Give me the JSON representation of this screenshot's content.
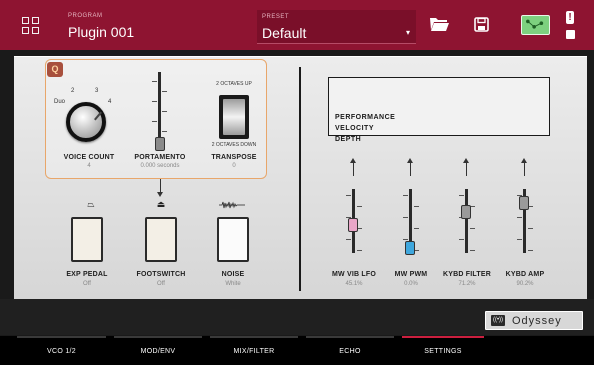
{
  "header": {
    "plugin_caption": "PROGRAM",
    "plugin_name": "Plugin 001",
    "preset_caption": "PRESET",
    "preset_value": "Default",
    "warning_glyph": "!"
  },
  "left_section": {
    "q_badge": "Q",
    "voice_count": {
      "label": "VOICE COUNT",
      "value": "4",
      "scale": [
        "Duo",
        "2",
        "3",
        "4"
      ]
    },
    "portamento": {
      "label": "PORTAMENTO",
      "value": "0.000 seconds"
    },
    "transpose": {
      "label": "TRANSPOSE",
      "value": "0",
      "top_text": "2 OCTAVES UP",
      "bottom_text": "2 OCTAVES DOWN"
    },
    "exp_pedal": {
      "label": "EXP PEDAL",
      "value": "Off"
    },
    "footswitch": {
      "label": "FOOTSWITCH",
      "value": "Off"
    },
    "noise": {
      "label": "NOISE",
      "value": "White"
    }
  },
  "right_section": {
    "display_lines": [
      "PERFORMANCE",
      "VELOCITY",
      "DEPTH"
    ],
    "sliders": [
      {
        "label": "MW VIB LFO",
        "value": "45.1%",
        "level": 0.451,
        "color": "#e9a6c8"
      },
      {
        "label": "MW PWM",
        "value": "0.0%",
        "level": 0.0,
        "color": "#3fa7dd"
      },
      {
        "label": "KYBD FILTER",
        "value": "71.2%",
        "level": 0.712,
        "color": "#9a9a9a"
      },
      {
        "label": "KYBD AMP",
        "value": "90.2%",
        "level": 0.902,
        "color": "#9a9a9a"
      }
    ]
  },
  "brand": {
    "name": "Odyssey",
    "logo_text": "((•))"
  },
  "tabs": [
    {
      "label": "VCO 1/2",
      "active": false
    },
    {
      "label": "MOD/ENV",
      "active": false
    },
    {
      "label": "MIX/FILTER",
      "active": false
    },
    {
      "label": "ECHO",
      "active": false
    },
    {
      "label": "SETTINGS",
      "active": true
    }
  ],
  "colors": {
    "accent": "#8e1431",
    "active_tab": "#cc1f3f",
    "highlight": "#e8a66a"
  },
  "icons": [
    "grid-icon",
    "folder-icon",
    "save-icon",
    "routing-icon",
    "warning-icon",
    "chip-icon",
    "pedal-icon",
    "footswitch-icon",
    "noise-icon"
  ]
}
